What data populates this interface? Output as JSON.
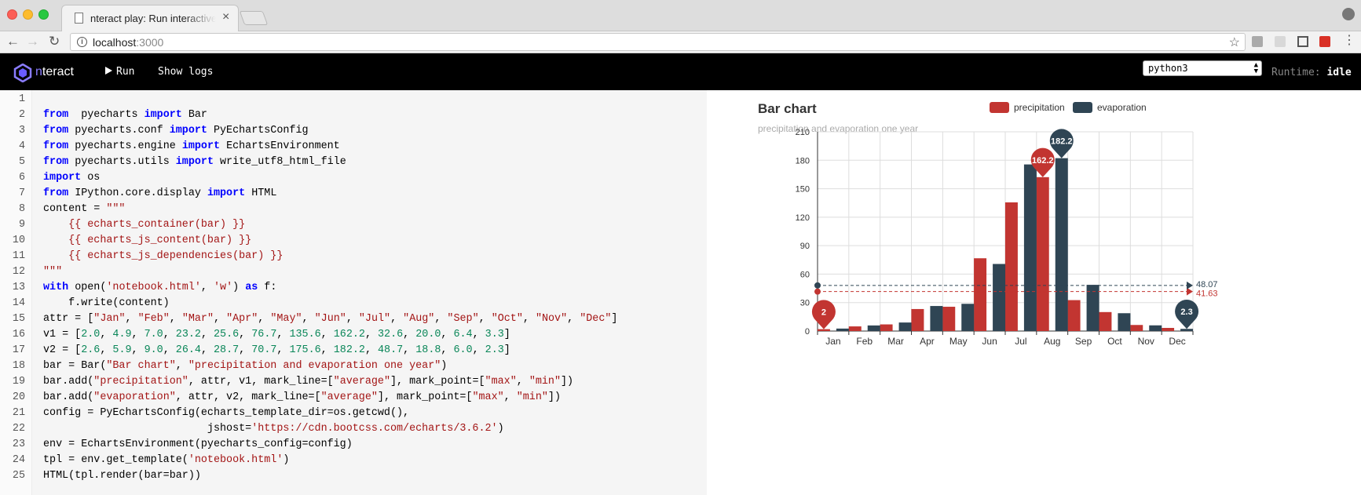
{
  "browser": {
    "tab_title": "nteract play: Run interactive code",
    "tab_close": "×",
    "url_host": "localhost",
    "url_port": ":3000",
    "info": "i",
    "nav_back": "←",
    "nav_forward": "→",
    "reload": "↻",
    "star": "☆"
  },
  "app": {
    "logo_prefix": "n",
    "logo_rest": "teract",
    "run_label": "Run",
    "show_logs_label": "Show logs",
    "kernel_selected": "python3",
    "runtime_label": "Runtime:",
    "runtime_status": "idle"
  },
  "code": {
    "line_numbers": [
      "1",
      "2",
      "3",
      "4",
      "5",
      "6",
      "7",
      "8",
      "9",
      "10",
      "11",
      "12",
      "13",
      "14",
      "15",
      "16",
      "17",
      "18",
      "19",
      "20",
      "21",
      "22",
      "23",
      "24",
      "25"
    ],
    "lines": [
      [],
      [
        [
          "kw",
          "from"
        ],
        [
          "",
          "  pyecharts "
        ],
        [
          "kw",
          "import"
        ],
        [
          "",
          " Bar"
        ]
      ],
      [
        [
          "kw",
          "from"
        ],
        [
          "",
          " pyecharts.conf "
        ],
        [
          "kw",
          "import"
        ],
        [
          "",
          " PyEchartsConfig"
        ]
      ],
      [
        [
          "kw",
          "from"
        ],
        [
          "",
          " pyecharts.engine "
        ],
        [
          "kw",
          "import"
        ],
        [
          "",
          " EchartsEnvironment"
        ]
      ],
      [
        [
          "kw",
          "from"
        ],
        [
          "",
          " pyecharts.utils "
        ],
        [
          "kw",
          "import"
        ],
        [
          "",
          " write_utf8_html_file"
        ]
      ],
      [
        [
          "kw",
          "import"
        ],
        [
          "",
          " os"
        ]
      ],
      [
        [
          "kw",
          "from"
        ],
        [
          "",
          " IPython.core.display "
        ],
        [
          "kw",
          "import"
        ],
        [
          "",
          " HTML"
        ]
      ],
      [
        [
          "",
          "content = "
        ],
        [
          "str",
          "\"\"\""
        ]
      ],
      [
        [
          "str",
          "    {{ echarts_container(bar) }}"
        ]
      ],
      [
        [
          "str",
          "    {{ echarts_js_content(bar) }}"
        ]
      ],
      [
        [
          "str",
          "    {{ echarts_js_dependencies(bar) }}"
        ]
      ],
      [
        [
          "str",
          "\"\"\""
        ]
      ],
      [
        [
          "kw",
          "with"
        ],
        [
          "",
          " open("
        ],
        [
          "str",
          "'notebook.html'"
        ],
        [
          "",
          ", "
        ],
        [
          "str",
          "'w'"
        ],
        [
          "",
          ") "
        ],
        [
          "kw",
          "as"
        ],
        [
          "",
          " f:"
        ]
      ],
      [
        [
          "",
          "    f.write(content)"
        ]
      ],
      [
        [
          "",
          "attr = ["
        ],
        [
          "str",
          "\"Jan\""
        ],
        [
          "",
          ", "
        ],
        [
          "str",
          "\"Feb\""
        ],
        [
          "",
          ", "
        ],
        [
          "str",
          "\"Mar\""
        ],
        [
          "",
          ", "
        ],
        [
          "str",
          "\"Apr\""
        ],
        [
          "",
          ", "
        ],
        [
          "str",
          "\"May\""
        ],
        [
          "",
          ", "
        ],
        [
          "str",
          "\"Jun\""
        ],
        [
          "",
          ", "
        ],
        [
          "str",
          "\"Jul\""
        ],
        [
          "",
          ", "
        ],
        [
          "str",
          "\"Aug\""
        ],
        [
          "",
          ", "
        ],
        [
          "str",
          "\"Sep\""
        ],
        [
          "",
          ", "
        ],
        [
          "str",
          "\"Oct\""
        ],
        [
          "",
          ", "
        ],
        [
          "str",
          "\"Nov\""
        ],
        [
          "",
          ", "
        ],
        [
          "str",
          "\"Dec\""
        ],
        [
          "",
          "]"
        ]
      ],
      [
        [
          "",
          "v1 = ["
        ],
        [
          "num",
          "2.0"
        ],
        [
          "",
          ", "
        ],
        [
          "num",
          "4.9"
        ],
        [
          "",
          ", "
        ],
        [
          "num",
          "7.0"
        ],
        [
          "",
          ", "
        ],
        [
          "num",
          "23.2"
        ],
        [
          "",
          ", "
        ],
        [
          "num",
          "25.6"
        ],
        [
          "",
          ", "
        ],
        [
          "num",
          "76.7"
        ],
        [
          "",
          ", "
        ],
        [
          "num",
          "135.6"
        ],
        [
          "",
          ", "
        ],
        [
          "num",
          "162.2"
        ],
        [
          "",
          ", "
        ],
        [
          "num",
          "32.6"
        ],
        [
          "",
          ", "
        ],
        [
          "num",
          "20.0"
        ],
        [
          "",
          ", "
        ],
        [
          "num",
          "6.4"
        ],
        [
          "",
          ", "
        ],
        [
          "num",
          "3.3"
        ],
        [
          "",
          "]"
        ]
      ],
      [
        [
          "",
          "v2 = ["
        ],
        [
          "num",
          "2.6"
        ],
        [
          "",
          ", "
        ],
        [
          "num",
          "5.9"
        ],
        [
          "",
          ", "
        ],
        [
          "num",
          "9.0"
        ],
        [
          "",
          ", "
        ],
        [
          "num",
          "26.4"
        ],
        [
          "",
          ", "
        ],
        [
          "num",
          "28.7"
        ],
        [
          "",
          ", "
        ],
        [
          "num",
          "70.7"
        ],
        [
          "",
          ", "
        ],
        [
          "num",
          "175.6"
        ],
        [
          "",
          ", "
        ],
        [
          "num",
          "182.2"
        ],
        [
          "",
          ", "
        ],
        [
          "num",
          "48.7"
        ],
        [
          "",
          ", "
        ],
        [
          "num",
          "18.8"
        ],
        [
          "",
          ", "
        ],
        [
          "num",
          "6.0"
        ],
        [
          "",
          ", "
        ],
        [
          "num",
          "2.3"
        ],
        [
          "",
          "]"
        ]
      ],
      [
        [
          "",
          "bar = Bar("
        ],
        [
          "str",
          "\"Bar chart\""
        ],
        [
          "",
          ", "
        ],
        [
          "str",
          "\"precipitation and evaporation one year\""
        ],
        [
          "",
          ")"
        ]
      ],
      [
        [
          "",
          "bar.add("
        ],
        [
          "str",
          "\"precipitation\""
        ],
        [
          "",
          ", attr, v1, mark_line=["
        ],
        [
          "str",
          "\"average\""
        ],
        [
          "",
          "], mark_point=["
        ],
        [
          "str",
          "\"max\""
        ],
        [
          "",
          ", "
        ],
        [
          "str",
          "\"min\""
        ],
        [
          "",
          "])"
        ]
      ],
      [
        [
          "",
          "bar.add("
        ],
        [
          "str",
          "\"evaporation\""
        ],
        [
          "",
          ", attr, v2, mark_line=["
        ],
        [
          "str",
          "\"average\""
        ],
        [
          "",
          "], mark_point=["
        ],
        [
          "str",
          "\"max\""
        ],
        [
          "",
          ", "
        ],
        [
          "str",
          "\"min\""
        ],
        [
          "",
          "])"
        ]
      ],
      [
        [
          "",
          "config = PyEchartsConfig(echarts_template_dir=os.getcwd(),"
        ]
      ],
      [
        [
          "",
          "                          jshost="
        ],
        [
          "str",
          "'https://cdn.bootcss.com/echarts/3.6.2'"
        ],
        [
          "",
          ")"
        ]
      ],
      [
        [
          "",
          "env = EchartsEnvironment(pyecharts_config=config)"
        ]
      ],
      [
        [
          "",
          "tpl = env.get_template("
        ],
        [
          "str",
          "'notebook.html'"
        ],
        [
          "",
          ")"
        ]
      ],
      [
        [
          "",
          "HTML(tpl.render(bar=bar))"
        ]
      ]
    ]
  },
  "chart_data": {
    "type": "bar",
    "title": "Bar chart",
    "subtitle": "precipitation and evaporation one year",
    "categories": [
      "Jan",
      "Feb",
      "Mar",
      "Apr",
      "May",
      "Jun",
      "Jul",
      "Aug",
      "Sep",
      "Oct",
      "Nov",
      "Dec"
    ],
    "series": [
      {
        "name": "precipitation",
        "color": "#c23531",
        "values": [
          2.0,
          4.9,
          7.0,
          23.2,
          25.6,
          76.7,
          135.6,
          162.2,
          32.6,
          20.0,
          6.4,
          3.3
        ],
        "average": 41.63,
        "mark_points": [
          {
            "label": "162.2",
            "index": 7
          },
          {
            "label": "2",
            "index": 0
          }
        ]
      },
      {
        "name": "evaporation",
        "color": "#2f4554",
        "values": [
          2.6,
          5.9,
          9.0,
          26.4,
          28.7,
          70.7,
          175.6,
          182.2,
          48.7,
          18.8,
          6.0,
          2.3
        ],
        "average": 48.07,
        "mark_points": [
          {
            "label": "182.2",
            "index": 7
          },
          {
            "label": "2.3",
            "index": 11
          }
        ]
      }
    ],
    "y_ticks": [
      "0",
      "30",
      "60",
      "90",
      "120",
      "150",
      "180",
      "210"
    ],
    "ylim": [
      0,
      210
    ],
    "average_labels": [
      "41.63",
      "48.07"
    ],
    "grid": true,
    "legend_position": "top"
  }
}
